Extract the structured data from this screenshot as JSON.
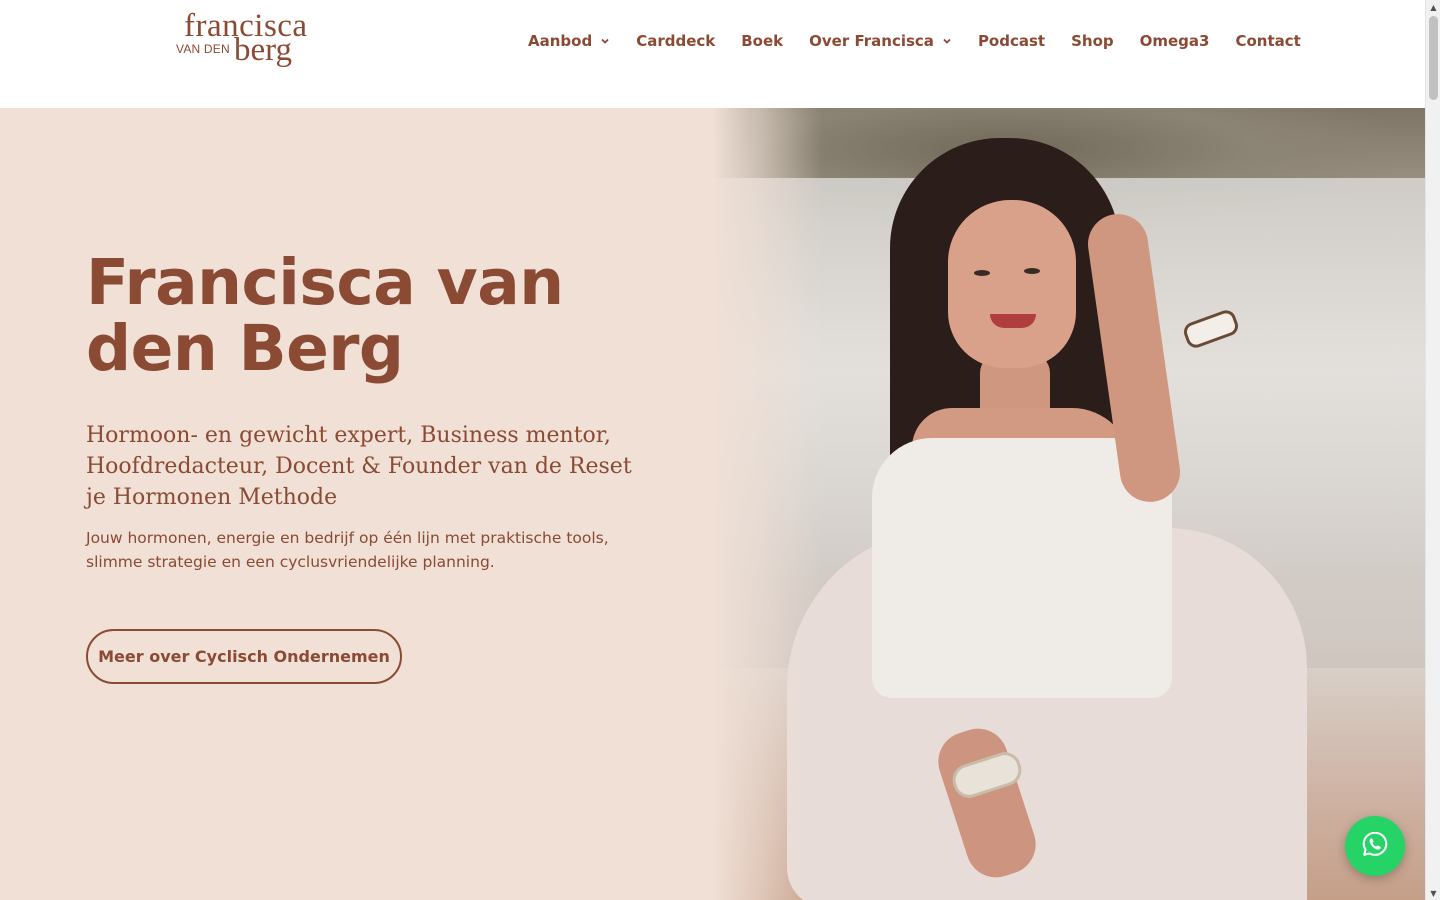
{
  "header": {
    "logo": {
      "line1": "francisca",
      "line2": "VAN DEN",
      "line3": "berg"
    },
    "nav": [
      {
        "label": "Aanbod",
        "has_dropdown": true
      },
      {
        "label": "Carddeck",
        "has_dropdown": false
      },
      {
        "label": "Boek",
        "has_dropdown": false
      },
      {
        "label": "Over Francisca",
        "has_dropdown": true
      },
      {
        "label": "Podcast",
        "has_dropdown": false
      },
      {
        "label": "Shop",
        "has_dropdown": false
      },
      {
        "label": "Omega3",
        "has_dropdown": false
      },
      {
        "label": "Contact",
        "has_dropdown": false
      }
    ]
  },
  "hero": {
    "title": "Francisca van den Berg",
    "subtitle": "Hormoon- en gewicht expert, Business mentor, Hoofdredacteur, Docent & Founder van de Reset je Hormonen Methode",
    "text": "Jouw hormonen, energie en bedrijf op één lijn met praktische tools, slimme strategie en een cyclusvriendelijke planning.",
    "cta_label": "Meer over Cyclisch Ondernemen"
  },
  "colors": {
    "brand": "#8a4a33",
    "hero_bg": "#f0e0d6",
    "whatsapp": "#25d366"
  },
  "icons": {
    "dropdown": "chevron-down-icon",
    "chat": "whatsapp-icon"
  }
}
